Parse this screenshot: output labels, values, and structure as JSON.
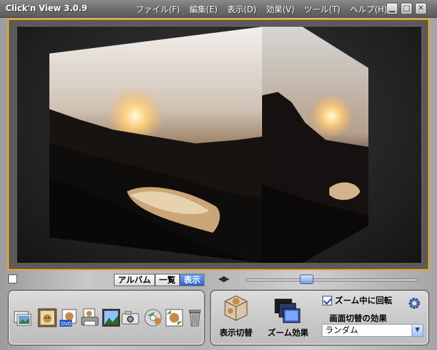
{
  "window": {
    "title": "Click'n View 3.0.9",
    "buttons": {
      "minimize": "▁",
      "maximize": "□",
      "close": "✕"
    }
  },
  "menu": [
    "ファイル(F)",
    "編集(E)",
    "表示(D)",
    "効果(V)",
    "ツール(T)",
    "ヘルプ(H)"
  ],
  "view_tabs": {
    "items": [
      "アルバム",
      "一覧",
      "表示"
    ],
    "active": "表示"
  },
  "nav_arrows": "◀▶",
  "slider": {
    "position": 0.34
  },
  "toolbar_icons": [
    "photos-icon",
    "dog-portrait-icon",
    "dog-dvd-icon",
    "dog-print-icon",
    "landscape-frame-icon",
    "camera-icon",
    "cd-disc-icon",
    "dog-refresh-icon",
    "trash-icon"
  ],
  "right_panel": {
    "display_switch_label": "表示切替",
    "zoom_effect_label": "ズーム効果",
    "rotate_while_zoom_label": "ズーム中に回転",
    "rotate_while_zoom_checked": true,
    "transition_effect_label": "画面切替の効果",
    "transition_effect_value": "ランダム"
  },
  "colors": {
    "frame_accent": "#e8a23a",
    "active_tab": "#2a62d6"
  }
}
